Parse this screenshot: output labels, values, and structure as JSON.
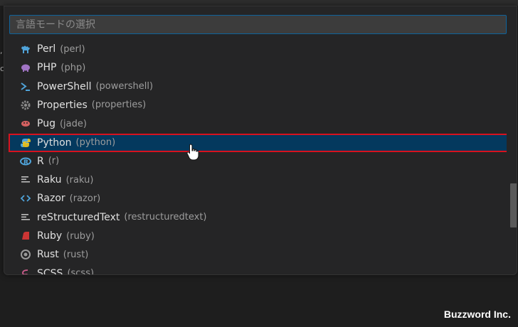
{
  "search": {
    "placeholder": "言語モードの選択",
    "value": ""
  },
  "languages": [
    {
      "label": "Perl",
      "id": "(perl)",
      "icon": "camel-icon",
      "color": "#4fa3d9"
    },
    {
      "label": "PHP",
      "id": "(php)",
      "icon": "elephant-icon",
      "color": "#a074c4"
    },
    {
      "label": "PowerShell",
      "id": "(powershell)",
      "icon": "terminal-icon",
      "color": "#4fa3d9"
    },
    {
      "label": "Properties",
      "id": "(properties)",
      "icon": "gear-icon",
      "color": "#8c8c8c"
    },
    {
      "label": "Pug",
      "id": "(jade)",
      "icon": "pug-icon",
      "color": "#d46060"
    },
    {
      "label": "Python",
      "id": "(python)",
      "icon": "python-icon",
      "color": "#4fa3d9",
      "selected": true
    },
    {
      "label": "R",
      "id": "(r)",
      "icon": "r-icon",
      "color": "#4fa3d9"
    },
    {
      "label": "Raku",
      "id": "(raku)",
      "icon": "lines-icon",
      "color": "#bdbdbd"
    },
    {
      "label": "Razor",
      "id": "(razor)",
      "icon": "code-brackets-icon",
      "color": "#4fa3d9"
    },
    {
      "label": "reStructuredText",
      "id": "(restructuredtext)",
      "icon": "lines-icon",
      "color": "#bdbdbd"
    },
    {
      "label": "Ruby",
      "id": "(ruby)",
      "icon": "ruby-icon",
      "color": "#cc3534"
    },
    {
      "label": "Rust",
      "id": "(rust)",
      "icon": "rust-icon",
      "color": "#9a9a9a"
    },
    {
      "label": "SCSS",
      "id": "(scss)",
      "icon": "sass-icon",
      "color": "#cd5c8c"
    }
  ],
  "watermark": "Buzzword Inc."
}
